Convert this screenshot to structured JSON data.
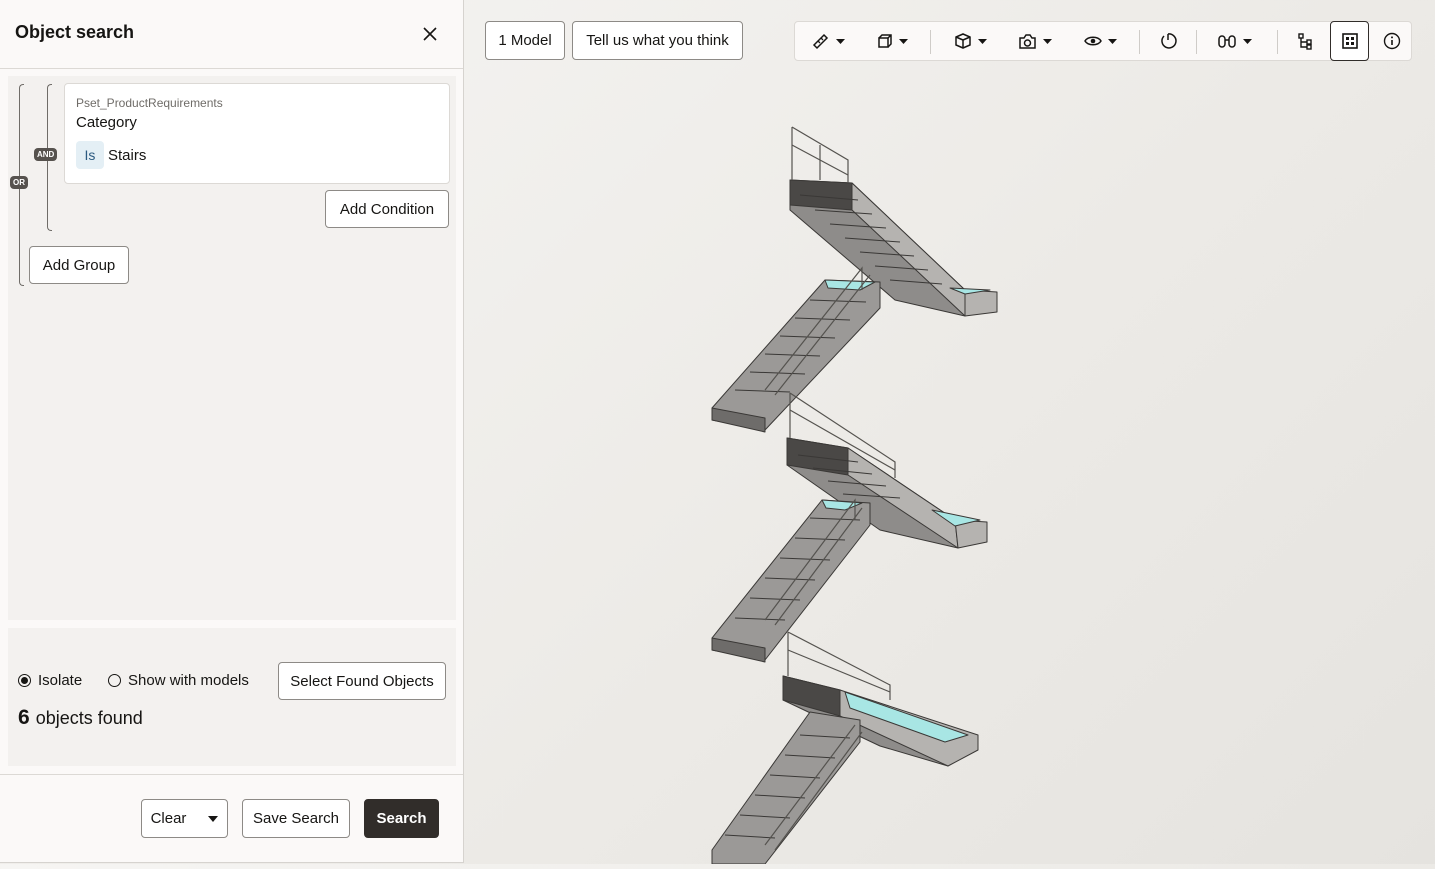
{
  "panel": {
    "title": "Object search",
    "close_icon": "close-icon"
  },
  "query": {
    "group_operator": "OR",
    "condition_operator": "AND",
    "condition": {
      "property_set": "Pset_ProductRequirements",
      "property": "Category",
      "operator": "Is",
      "value": "Stairs"
    },
    "add_condition_label": "Add Condition",
    "add_group_label": "Add Group"
  },
  "results": {
    "isolate_label": "Isolate",
    "show_with_models_label": "Show with models",
    "selected_mode": "Isolate",
    "select_found_label": "Select Found Objects",
    "count": "6",
    "count_suffix": "objects found"
  },
  "footer": {
    "clear_label": "Clear",
    "save_label": "Save Search",
    "search_label": "Search"
  },
  "top": {
    "model_label": "1 Model",
    "feedback_label": "Tell us what you think"
  },
  "toolbar": {
    "tools": [
      "measure-icon",
      "section-box-icon",
      "view-cube-icon",
      "camera-icon",
      "visibility-eye-icon",
      "reset-view-icon",
      "walk-binoculars-icon",
      "hierarchy-icon",
      "grid-panels-icon",
      "info-icon"
    ],
    "active_tool": "grid-panels-icon"
  },
  "colors": {
    "primary_button": "#312d2a",
    "operator_chip": "#e4eff5",
    "glass_highlight": "#a8e6e4"
  }
}
